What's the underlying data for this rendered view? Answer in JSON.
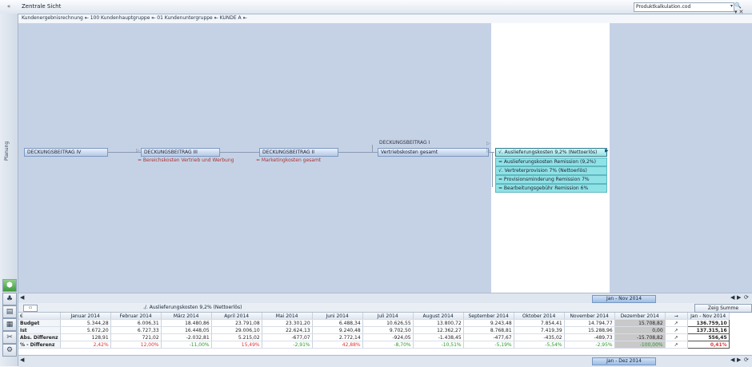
{
  "window": {
    "title": "Zentrale Sicht",
    "collapse_icon": "«"
  },
  "file": {
    "name": "Produktkalkulation.cod",
    "buttons": "🔍▾✕"
  },
  "breadcrumb": "Kundenergebnisrechnung ⇤ 100 Kundenhauptgruppe ⇤ 01 Kundenuntergruppe ⇤ KUNDE A ⇤",
  "sidebar": {
    "label": "Planung",
    "icon_names": [
      "chart-icon",
      "tree-icon",
      "table-icon",
      "report-icon",
      "tools-icon",
      "settings-icon"
    ]
  },
  "flow": {
    "db4": "DECKUNGSBEITRAG IV",
    "db3": "DECKUNGSBEITRAG III",
    "db3_sub": "= Bereichskosten Vertrieb und Werbung",
    "db2": "DECKUNGSBEITRAG II",
    "db2_sub": "= Marketingkosten gesamt",
    "db1_header": "DECKUNGSBEITRAG I",
    "db1_sub": "Vertriebskosten gesamt",
    "items": [
      "√. Auslieferungskosten 9,2% (Nettoerlös)",
      "= Auslieferungskosten Remission (9,2%)",
      "√. Vertreterprovision 7% (Nettoerlös)",
      "= Provisionsminderung Remission 7%",
      "= Bearbeitungsgebühr Remission 6%"
    ]
  },
  "scroll_top": {
    "range": "Jan - Nov 2014"
  },
  "grid_toolbar": {
    "caption": "./. Auslieferungskosten 9,2% (Nettoerlös)",
    "zero_button": "Zeig Summe"
  },
  "table": {
    "corner": "€",
    "months": [
      "Januar 2014",
      "Februar 2014",
      "März 2014",
      "April 2014",
      "Mai 2014",
      "Juni 2014",
      "Juli 2014",
      "August 2014",
      "September 2014",
      "Oktober 2014",
      "November 2014",
      "Dezember 2014"
    ],
    "arrow_header": "→",
    "range_header": "Jan - Nov 2014",
    "rows": [
      {
        "label": "Budget",
        "values": [
          "5.344,28",
          "6.006,31",
          "18.480,86",
          "23.791,08",
          "23.301,20",
          "6.488,34",
          "10.626,55",
          "13.800,72",
          "9.243,48",
          "7.854,41",
          "14.794,77",
          "15.708,82"
        ],
        "arrow": "↗",
        "sum": "136.759,10"
      },
      {
        "label": "Ist",
        "values": [
          "5.672,20",
          "6.727,33",
          "16.448,05",
          "29.006,10",
          "22.624,13",
          "9.240,48",
          "9.702,50",
          "12.362,27",
          "8.768,81",
          "7.419,39",
          "15.288,96",
          "0,00"
        ],
        "arrow": "↗",
        "sum": "137.315,16"
      },
      {
        "label": "Abs. Differenz",
        "values": [
          "128,91",
          "721,02",
          "-2.032,81",
          "5.215,02",
          "-677,07",
          "2.772,14",
          "-924,05",
          "-1.438,45",
          "-477,67",
          "-435,02",
          "-489,73",
          "-15.708,82"
        ],
        "arrow": "↗",
        "sum": "556,45"
      },
      {
        "label": "% - Differenz",
        "values": [
          "2,42%",
          "12,00%",
          "-11,00%",
          "15,49%",
          "-2,91%",
          "42,88%",
          "-8,70%",
          "-10,51%",
          "-5,19%",
          "-5,54%",
          "-2,95%",
          "-100,00%"
        ],
        "arrow": "↗",
        "sum": "0,41%"
      }
    ]
  },
  "scroll_bottom": {
    "range": "Jan - Dez 2014"
  }
}
